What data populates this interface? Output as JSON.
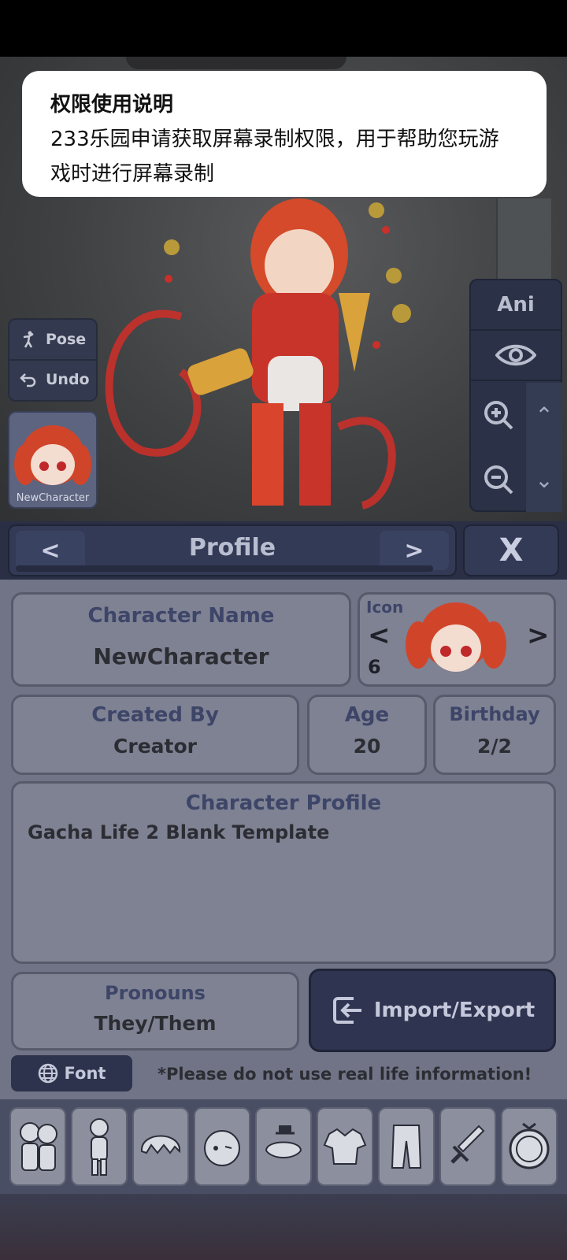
{
  "permission_dialog": {
    "title": "权限使用说明",
    "body": "233乐园申请获取屏幕录制权限，用于帮助您玩游戏时进行屏幕录制"
  },
  "left_controls": {
    "pose_label": "Pose",
    "undo_label": "Undo",
    "avatar_name": "NewCharacter"
  },
  "right_controls": {
    "ani_label": "Ani"
  },
  "header": {
    "title": "Profile",
    "prev": "<",
    "next": ">",
    "close": "X"
  },
  "profile": {
    "character_name_title": "Character Name",
    "character_name_value": "NewCharacter",
    "icon_label": "Icon",
    "icon_index": "6",
    "icon_prev": "<",
    "icon_next": ">",
    "created_by_title": "Created By",
    "created_by_value": "Creator",
    "age_title": "Age",
    "age_value": "20",
    "birthday_title": "Birthday",
    "birthday_value": "2/2",
    "character_profile_title": "Character Profile",
    "character_profile_value": "Gacha Life 2 Blank Template",
    "pronouns_title": "Pronouns",
    "pronouns_value": "They/Them",
    "import_export_label": "Import/Export",
    "font_label": "Font",
    "warning": "*Please do not use real life information!"
  },
  "categories": [
    {
      "icon": "characters-icon"
    },
    {
      "icon": "body-icon"
    },
    {
      "icon": "hair-icon"
    },
    {
      "icon": "face-icon"
    },
    {
      "icon": "accessories-icon"
    },
    {
      "icon": "top-icon"
    },
    {
      "icon": "bottom-icon"
    },
    {
      "icon": "weapons-icon"
    },
    {
      "icon": "profile-icon"
    }
  ],
  "colors": {
    "dialog_bg": "#ffffff",
    "panel_bg": "#717486",
    "header_bg": "#333a55",
    "title_text": "#3d4568"
  }
}
